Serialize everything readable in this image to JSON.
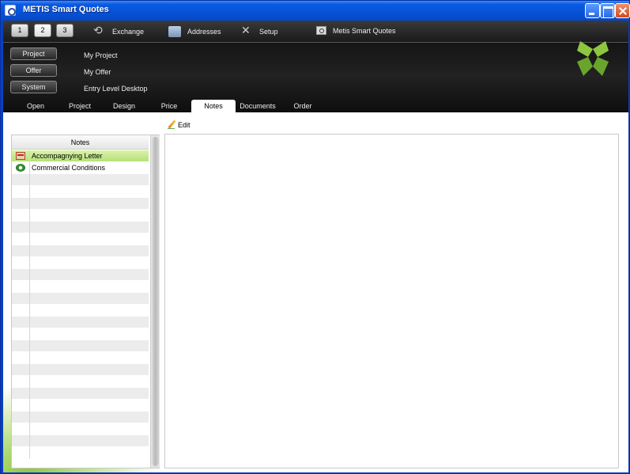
{
  "window": {
    "title": "METIS Smart Quotes"
  },
  "toolbar": {
    "num_buttons": [
      "1",
      "2",
      "3"
    ],
    "items": [
      {
        "label": "Exchange",
        "icon": "exchange-icon"
      },
      {
        "label": "Addresses",
        "icon": "addresses-icon"
      },
      {
        "label": "Setup",
        "icon": "setup-icon"
      },
      {
        "label": "Metis Smart Quotes",
        "icon": "metis-icon"
      }
    ]
  },
  "context": [
    {
      "button": "Project",
      "value": "My Project"
    },
    {
      "button": "Offer",
      "value": "My Offer"
    },
    {
      "button": "System",
      "value": "Entry Level Desktop"
    }
  ],
  "tabs": [
    "Open",
    "Project",
    "Design",
    "Price",
    "Notes",
    "Documents",
    "Order"
  ],
  "active_tab": "Notes",
  "edit_label": "Edit",
  "notes": {
    "header": "Notes",
    "items": [
      {
        "label": "Accompagnying Letter",
        "icon": "letter-icon",
        "selected": true
      },
      {
        "label": "Commercial Conditions",
        "icon": "gear-icon",
        "selected": false
      }
    ]
  },
  "colors": {
    "accent_green": "#8ec63f",
    "selection": "#b7e07a",
    "title_blue": "#0553d8",
    "header_dark": "#1a1a1a"
  }
}
